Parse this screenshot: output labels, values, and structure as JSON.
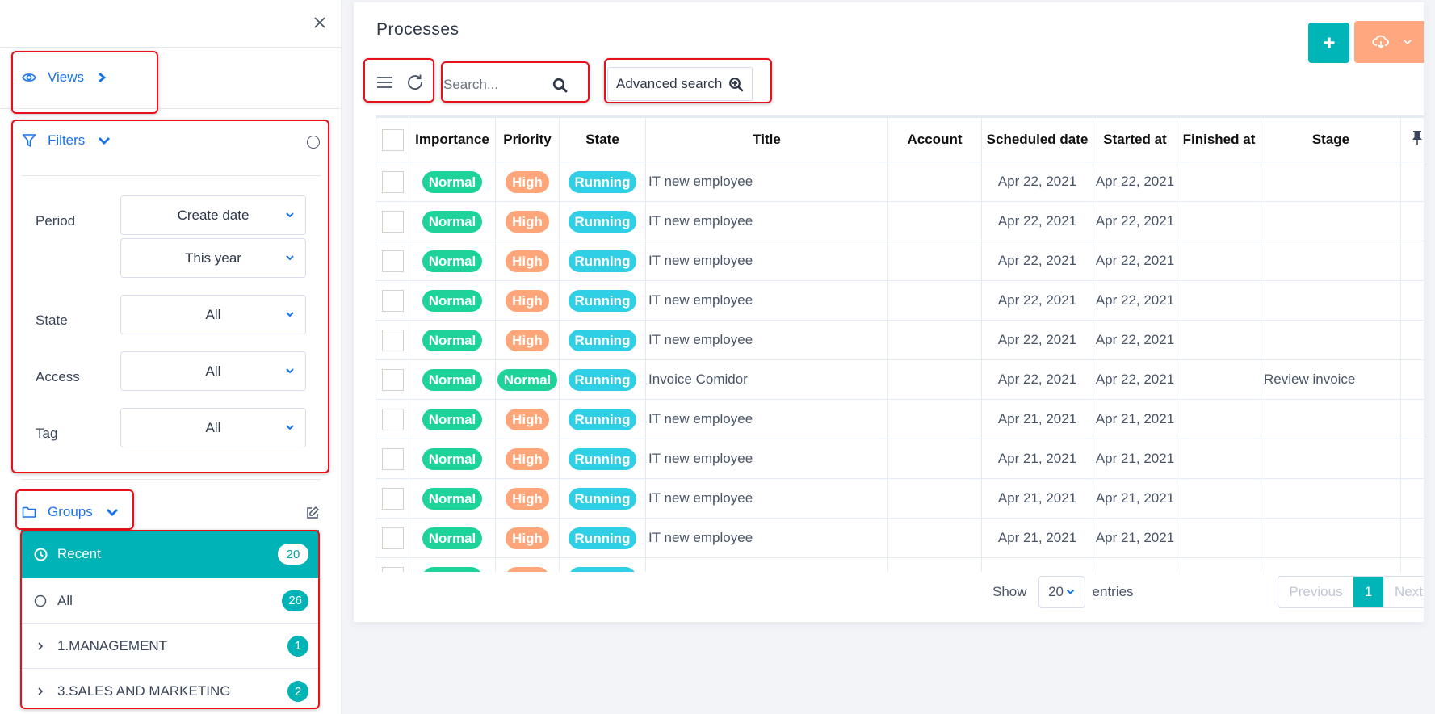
{
  "sidebar": {
    "views_label": "Views",
    "filters_label": "Filters",
    "filters": {
      "period_label": "Period",
      "period_type": "Create date",
      "period_range": "This year",
      "state_label": "State",
      "state_value": "All",
      "access_label": "Access",
      "access_value": "All",
      "tag_label": "Tag",
      "tag_value": "All"
    },
    "groups_label": "Groups",
    "groups": [
      {
        "label": "Recent",
        "count": "20",
        "icon": "clock-icon",
        "active": true
      },
      {
        "label": "All",
        "count": "26",
        "icon": "circle-icon",
        "active": false
      },
      {
        "label": "1.MANAGEMENT",
        "count": "1",
        "icon": "chevron-right-icon",
        "active": false
      },
      {
        "label": "3.SALES AND MARKETING",
        "count": "2",
        "icon": "chevron-right-icon",
        "active": false
      }
    ]
  },
  "main": {
    "title": "Processes",
    "search_placeholder": "Search...",
    "advanced_search_label": "Advanced search",
    "columns": [
      "Importance",
      "Priority",
      "State",
      "Title",
      "Account",
      "Scheduled date",
      "Started at",
      "Finished at",
      "Stage"
    ],
    "rows": [
      {
        "importance": "Normal",
        "priority": "High",
        "state": "Running",
        "title": "IT new employee",
        "account": "",
        "scheduled": "Apr 22, 2021",
        "started": "Apr 22, 2021",
        "finished": "",
        "stage": ""
      },
      {
        "importance": "Normal",
        "priority": "High",
        "state": "Running",
        "title": "IT new employee",
        "account": "",
        "scheduled": "Apr 22, 2021",
        "started": "Apr 22, 2021",
        "finished": "",
        "stage": ""
      },
      {
        "importance": "Normal",
        "priority": "High",
        "state": "Running",
        "title": "IT new employee",
        "account": "",
        "scheduled": "Apr 22, 2021",
        "started": "Apr 22, 2021",
        "finished": "",
        "stage": ""
      },
      {
        "importance": "Normal",
        "priority": "High",
        "state": "Running",
        "title": "IT new employee",
        "account": "",
        "scheduled": "Apr 22, 2021",
        "started": "Apr 22, 2021",
        "finished": "",
        "stage": ""
      },
      {
        "importance": "Normal",
        "priority": "High",
        "state": "Running",
        "title": "IT new employee",
        "account": "",
        "scheduled": "Apr 22, 2021",
        "started": "Apr 22, 2021",
        "finished": "",
        "stage": ""
      },
      {
        "importance": "Normal",
        "priority": "Normal",
        "state": "Running",
        "title": "Invoice Comidor",
        "account": "",
        "scheduled": "Apr 22, 2021",
        "started": "Apr 22, 2021",
        "finished": "",
        "stage": "Review invoice"
      },
      {
        "importance": "Normal",
        "priority": "High",
        "state": "Running",
        "title": "IT new employee",
        "account": "",
        "scheduled": "Apr 21, 2021",
        "started": "Apr 21, 2021",
        "finished": "",
        "stage": ""
      },
      {
        "importance": "Normal",
        "priority": "High",
        "state": "Running",
        "title": "IT new employee",
        "account": "",
        "scheduled": "Apr 21, 2021",
        "started": "Apr 21, 2021",
        "finished": "",
        "stage": ""
      },
      {
        "importance": "Normal",
        "priority": "High",
        "state": "Running",
        "title": "IT new employee",
        "account": "",
        "scheduled": "Apr 21, 2021",
        "started": "Apr 21, 2021",
        "finished": "",
        "stage": ""
      },
      {
        "importance": "Normal",
        "priority": "High",
        "state": "Running",
        "title": "IT new employee",
        "account": "",
        "scheduled": "Apr 21, 2021",
        "started": "Apr 21, 2021",
        "finished": "",
        "stage": ""
      },
      {
        "importance": "Normal",
        "priority": "High",
        "state": "Running",
        "title": "",
        "account": "",
        "scheduled": "",
        "started": "",
        "finished": "",
        "stage": ""
      }
    ],
    "pagination": {
      "show_label": "Show",
      "page_size": "20",
      "entries_label": "entries",
      "previous_label": "Previous",
      "current_page": "1",
      "next_label": "Next"
    }
  },
  "colors": {
    "normal": "#1dd39a",
    "high": "#ffa57a",
    "running": "#2fcfe6",
    "accent_teal": "#00b5b8",
    "export_orange": "#ffa77e",
    "link_blue": "#1a73e8"
  }
}
